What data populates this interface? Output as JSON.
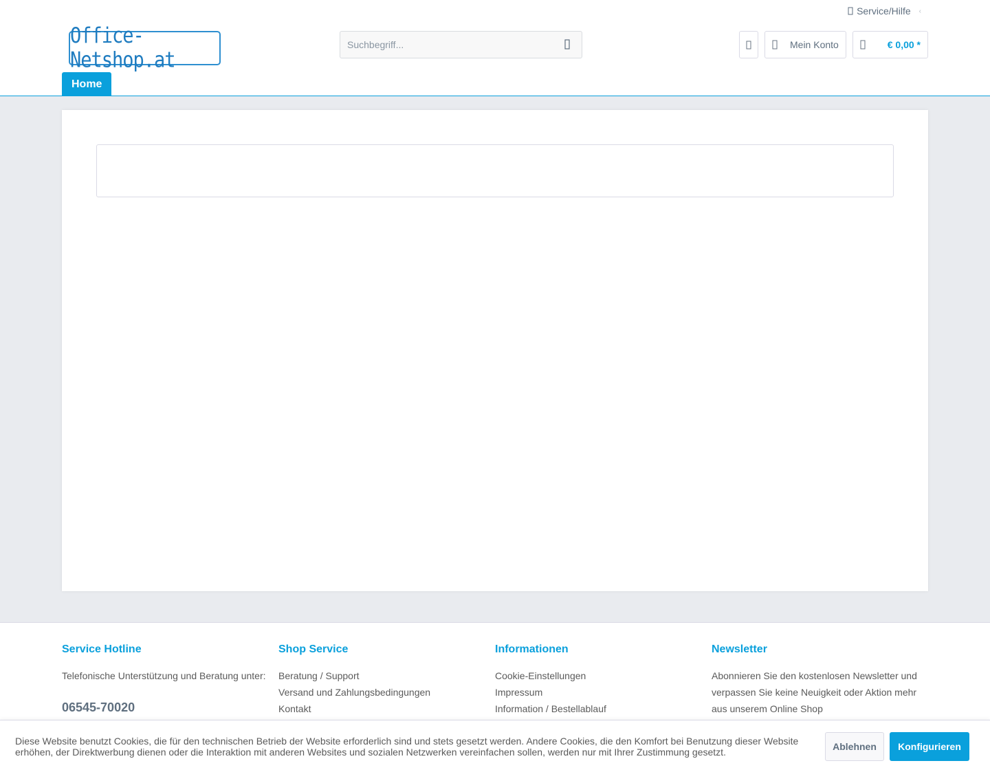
{
  "topbar": {
    "service_label": "Service/Hilfe"
  },
  "header": {
    "logo_text": "Office-Netshop.at",
    "search_placeholder": "Suchbegriff...",
    "account_label": "Mein Konto",
    "cart_total": "€ 0,00 *"
  },
  "nav": {
    "items": [
      {
        "label": "Home",
        "active": true
      }
    ]
  },
  "footer": {
    "hotline": {
      "title": "Service Hotline",
      "text": "Telefonische Unterstützung und Beratung unter:",
      "phone": "06545-70020"
    },
    "shop_service": {
      "title": "Shop Service",
      "links": [
        "Beratung / Support",
        "Versand und Zahlungsbedingungen",
        "Kontakt"
      ]
    },
    "informationen": {
      "title": "Informationen",
      "links": [
        "Cookie-Einstellungen",
        "Impressum",
        "Information / Bestellablauf"
      ]
    },
    "newsletter": {
      "title": "Newsletter",
      "text": "Abonnieren Sie den kostenlosen Newsletter und verpassen Sie keine Neuigkeit oder Aktion mehr aus unserem Online Shop"
    }
  },
  "cookie": {
    "message": "Diese Website benutzt Cookies, die für den technischen Betrieb der Website erforderlich sind und stets gesetzt werden. Andere Cookies, die den Komfort bei Benutzung dieser Website erhöhen, der Direktwerbung dienen oder die Interaktion mit anderen Websites und sozialen Netzwerken vereinfachen sollen, werden nur mit Ihrer Zustimmung gesetzt.",
    "decline_label": "Ablehnen",
    "configure_label": "Konfigurieren"
  },
  "colors": {
    "accent": "#0aa0dc",
    "text": "#5a5a5a",
    "background": "#e9ebef"
  },
  "icons": {
    "service": "question-icon",
    "search": "search-icon",
    "wishlist": "heart-icon",
    "account": "user-icon",
    "cart": "cart-icon"
  }
}
